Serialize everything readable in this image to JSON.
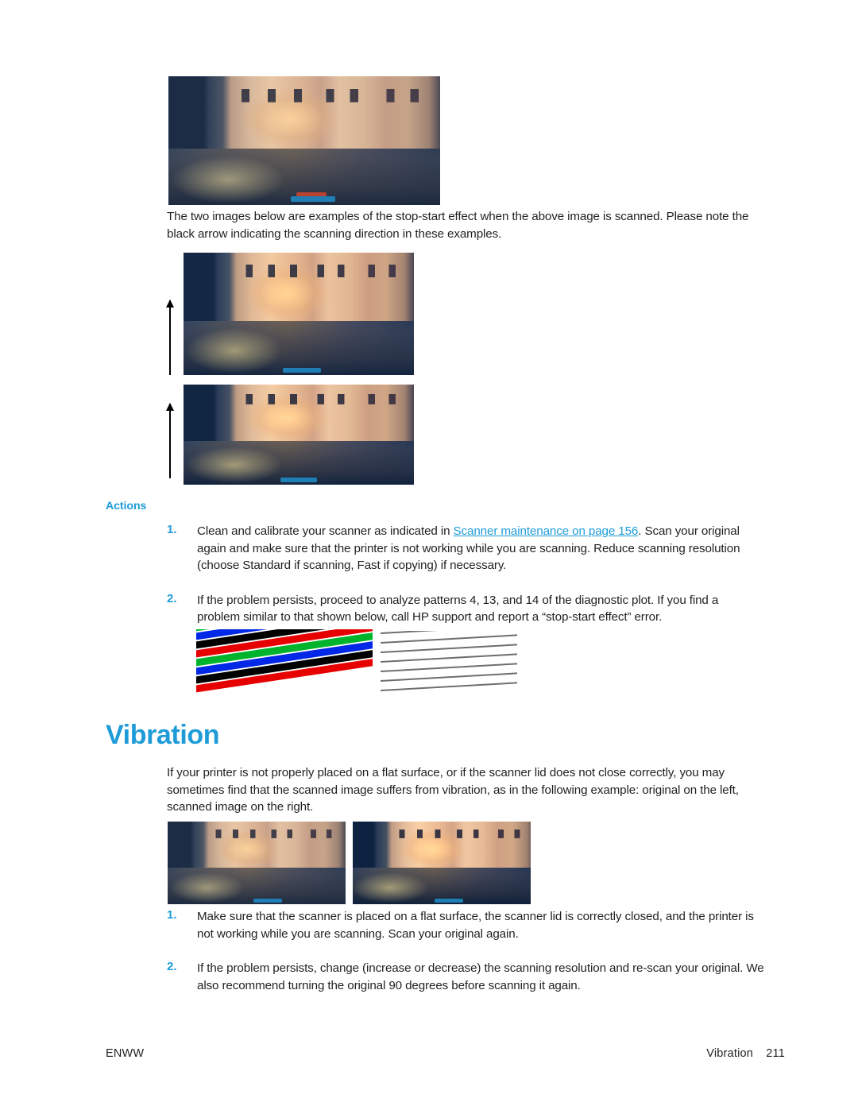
{
  "document": {
    "page_number": "211",
    "footer_left": "ENWW",
    "footer_right_section": "Vibration"
  },
  "colors": {
    "accent_blue": "#1f9cd8",
    "link_blue": "#1f9cd8",
    "body_text": "#231f20"
  },
  "intro_paragraph": "The two images below are examples of the stop-start effect when the above image is scanned. Please note the black arrow indicating the scanning direction in these examples.",
  "actions": {
    "label": "Actions",
    "items": [
      {
        "number": "1.",
        "text_before_link": "Clean and calibrate your scanner as indicated in ",
        "link_text": "Scanner maintenance on page 156",
        "text_after_link": ". Scan your original again and make sure that the printer is not working while you are scanning. Reduce scanning resolution (choose Standard if scanning, Fast if copying) if necessary."
      },
      {
        "number": "2.",
        "text": "If the problem persists, proceed to analyze patterns 4, 13, and 14 of the diagnostic plot. If you find a problem similar to that shown below, call HP support and report a “stop-start effect” error."
      }
    ]
  },
  "vibration": {
    "heading": "Vibration",
    "paragraph": "If your printer is not properly placed on a flat surface, or if the scanner lid does not close correctly, you may sometimes find that the scanned image suffers from vibration, as in the following example: original on the left, scanned image on the right.",
    "items": [
      {
        "number": "1.",
        "text": "Make sure that the scanner is placed on a flat surface, the scanner lid is correctly closed, and the printer is not working while you are scanning. Scan your original again."
      },
      {
        "number": "2.",
        "text": "If the problem persists, change (increase or decrease) the scanning resolution and re-scan your original. We also recommend turning the original 90 degrees before scanning it again."
      }
    ]
  },
  "figures": {
    "original_photo": {
      "caption_alt": "coastal-village-photo-original"
    },
    "stopstart_photo_1": {
      "caption_alt": "coastal-village-photo-stop-start-example-1",
      "arrow_direction": "up"
    },
    "stopstart_photo_2": {
      "caption_alt": "coastal-village-photo-stop-start-example-2",
      "arrow_direction": "up"
    },
    "vibration_original": {
      "caption_alt": "coastal-village-photo-original-left"
    },
    "vibration_scanned": {
      "caption_alt": "coastal-village-photo-scanned-right"
    },
    "diagnostic_plot": {
      "caption_alt": "diagnostic-plot-stop-start-pattern",
      "stripe_colors": [
        "#00b32c",
        "#0028e6",
        "#000000",
        "#e60000"
      ],
      "stripe_sequence": [
        "#00b32c",
        "#0028e6",
        "#000000",
        "#e60000",
        "#00b32c",
        "#0028e6",
        "#000000",
        "#e60000"
      ],
      "gray_line_count": 7,
      "gray_line_color": "#6e6e6e"
    }
  }
}
